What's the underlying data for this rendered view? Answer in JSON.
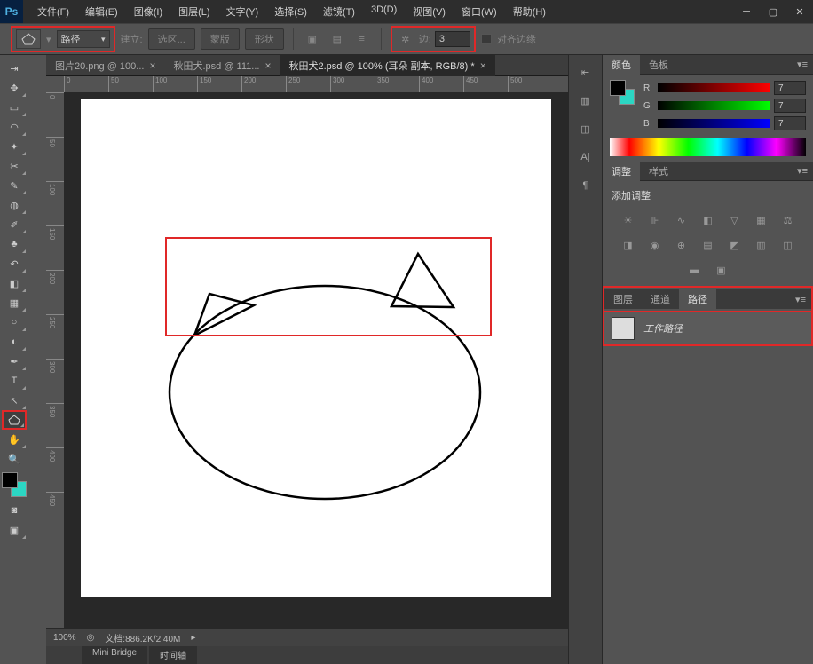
{
  "menu": {
    "file": "文件(F)",
    "edit": "编辑(E)",
    "image": "图像(I)",
    "layer": "图层(L)",
    "type": "文字(Y)",
    "select": "选择(S)",
    "filter": "滤镜(T)",
    "threed": "3D(D)",
    "view": "视图(V)",
    "window": "窗口(W)",
    "help": "帮助(H)"
  },
  "options": {
    "mode_label": "路径",
    "jianli_label": "建立:",
    "selection_btn": "选区...",
    "mask_btn": "蒙版",
    "shape_btn": "形状",
    "stroke_label": "边:",
    "stroke_value": "3",
    "align_label": "对齐边缘"
  },
  "tabs": [
    {
      "label": "图片20.png @ 100..."
    },
    {
      "label": "秋田犬.psd @ 111..."
    },
    {
      "label": "秋田犬2.psd @ 100% (耳朵 副本, RGB/8) *",
      "active": true
    }
  ],
  "ruler_ticks": [
    "0",
    "50",
    "100",
    "150",
    "200",
    "250",
    "300",
    "350",
    "400",
    "450",
    "500"
  ],
  "v_ruler_ticks": [
    "0",
    "50",
    "100",
    "150",
    "200",
    "250",
    "300",
    "350",
    "400",
    "450"
  ],
  "status": {
    "zoom": "100%",
    "doc_size_label": "文档:886.2K/2.40M"
  },
  "bottom_tabs": {
    "mini_bridge": "Mini Bridge",
    "timeline": "时间轴"
  },
  "panels": {
    "color_tab": "颜色",
    "swatches_tab": "色板",
    "adjustments_tab": "调整",
    "styles_tab": "样式",
    "adjustments_title": "添加调整",
    "layers_tab": "图层",
    "channels_tab": "通道",
    "paths_tab": "路径",
    "path_item_name": "工作路径"
  },
  "colors": {
    "r_label": "R",
    "r_value": "7",
    "g_label": "G",
    "g_value": "7",
    "b_label": "B",
    "b_value": "7"
  }
}
